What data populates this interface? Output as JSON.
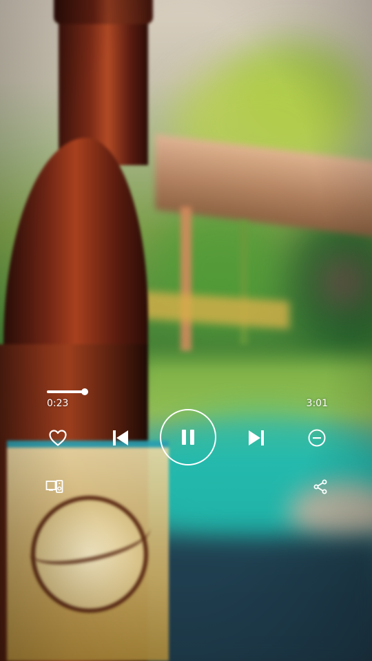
{
  "player": {
    "elapsed": "0:23",
    "total": "3:01",
    "progress": 0.135,
    "state": "playing",
    "accent_color": "#ffffff"
  },
  "controls": {
    "like_icon": "heart-outline-icon",
    "previous_icon": "skip-previous-icon",
    "play_pause_icon": "pause-icon",
    "next_icon": "skip-next-icon",
    "hide_icon": "minus-circle-icon",
    "devices_icon": "devices-icon",
    "share_icon": "share-icon"
  }
}
